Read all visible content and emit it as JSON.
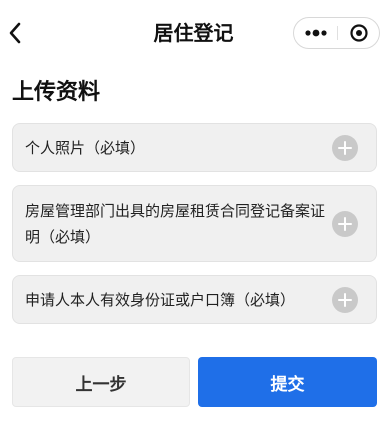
{
  "nav": {
    "title": "居住登记",
    "back_icon": "chevron-left-icon",
    "more_icon": "more-dots-icon",
    "close_icon": "target-circle-icon"
  },
  "section": {
    "title": "上传资料"
  },
  "uploads": [
    {
      "label": "个人照片（必填）",
      "icon": "plus-circle-icon"
    },
    {
      "label": "房屋管理部门出具的房屋租赁合同登记备案证明（必填）",
      "icon": "plus-circle-icon"
    },
    {
      "label": "申请人本人有效身份证或户口簿（必填）",
      "icon": "plus-circle-icon"
    }
  ],
  "actions": {
    "prev_label": "上一步",
    "submit_label": "提交"
  },
  "colors": {
    "primary": "#1f6fe8",
    "item_bg": "#f0f0f0",
    "icon_grey": "#c9c9c9"
  }
}
